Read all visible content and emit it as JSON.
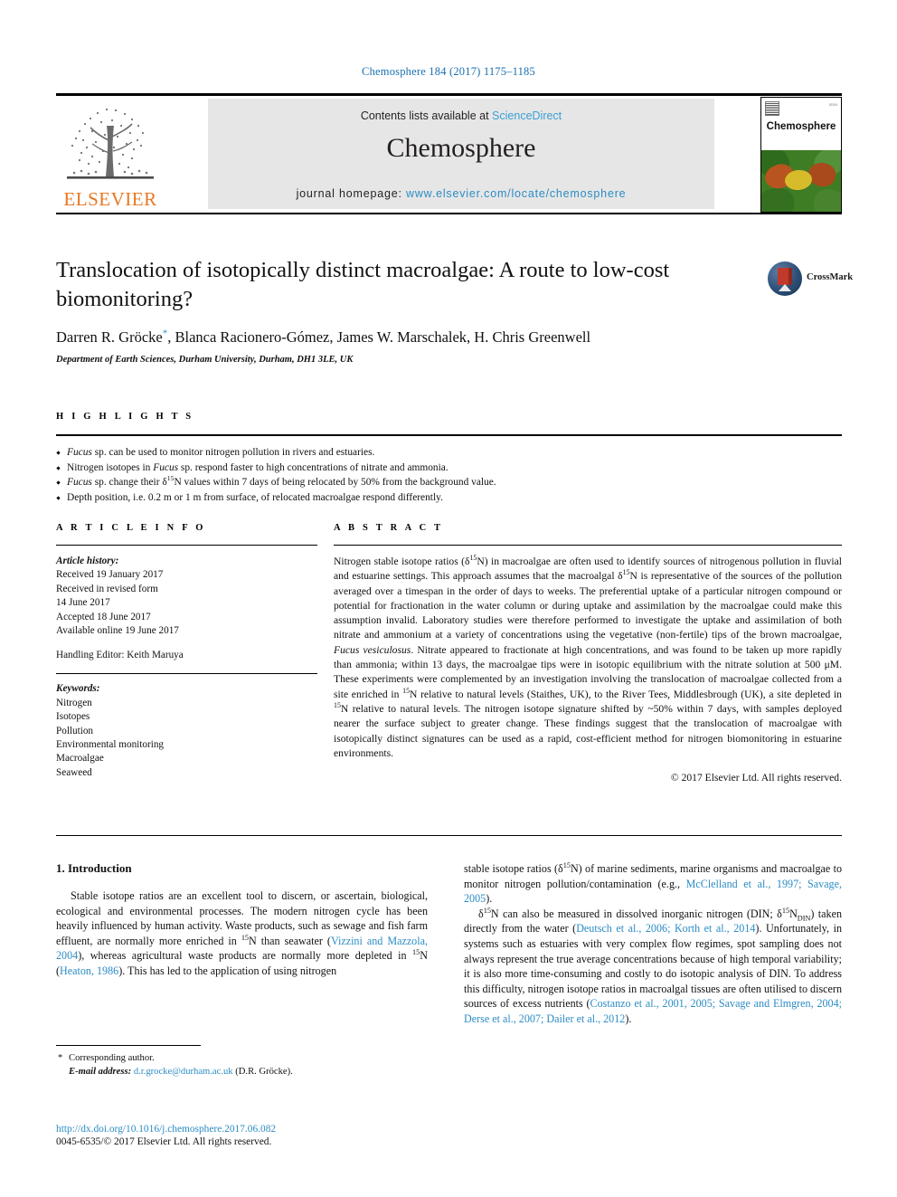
{
  "running_head": "Chemosphere 184 (2017) 1175–1185",
  "masthead": {
    "publisher_name": "ELSEVIER",
    "contents_prefix": "Contents lists available at",
    "contents_link": "ScienceDirect",
    "journal_name": "Chemosphere",
    "homepage_prefix": "journal homepage:",
    "homepage_link": "www.elsevier.com/locate/chemosphere",
    "cover_title": "Chemosphere"
  },
  "title": "Translocation of isotopically distinct macroalgae: A route to low-cost biomonitoring?",
  "crossmark_label": "CrossMark",
  "authors": "Darren R. Gröcke",
  "authors_rest": ", Blanca Racionero-Gómez, James W. Marschalek, H. Chris Greenwell",
  "author_marker": "*",
  "affiliation": "Department of Earth Sciences, Durham University, Durham, DH1 3LE, UK",
  "highlights": {
    "heading": "H I G H L I G H T S",
    "items": [
      {
        "italic": "Fucus",
        "rest": " sp. can be used to monitor nitrogen pollution in rivers and estuaries."
      },
      {
        "pre": "Nitrogen isotopes in ",
        "italic": "Fucus",
        "rest": " sp. respond faster to high concentrations of nitrate and ammonia."
      },
      {
        "italic": "Fucus",
        "rest": " sp. change their δ15N values within 7 days of being relocated by 50% from the background value."
      },
      {
        "rest": "Depth position, i.e. 0.2 m or 1 m from surface, of relocated macroalgae respond differently."
      }
    ]
  },
  "article_info": {
    "heading": "A R T I C L E   I N F O",
    "history_label": "Article history:",
    "history_lines": [
      "Received 19 January 2017",
      "Received in revised form",
      "14 June 2017",
      "Accepted 18 June 2017",
      "Available online 19 June 2017"
    ],
    "editor": "Handling Editor: Keith Maruya",
    "keywords_label": "Keywords:",
    "keywords": [
      "Nitrogen",
      "Isotopes",
      "Pollution",
      "Environmental monitoring",
      "Macroalgae",
      "Seaweed"
    ]
  },
  "abstract": {
    "heading": "A B S T R A C T",
    "p1_a": "Nitrogen stable isotope ratios (δ",
    "p1_b": "N) in macroalgae are often used to identify sources of nitrogenous pollution in fluvial and estuarine settings. This approach assumes that the macroalgal δ",
    "p1_c": "N is representative of the sources of the pollution averaged over a timespan in the order of days to weeks. The preferential uptake of a particular nitrogen compound or potential for fractionation in the water column or during uptake and assimilation by the macroalgae could make this assumption invalid. Laboratory studies were therefore performed to investigate the uptake and assimilation of both nitrate and ammonium at a variety of concentrations using the vegetative (non-fertile) tips of the brown macroalgae, ",
    "species": "Fucus vesiculosus",
    "p1_d": ". Nitrate appeared to fractionate at high concentrations, and was found to be taken up more rapidly than ammonia; within 13 days, the macroalgae tips were in isotopic equilibrium with the nitrate solution at 500 μM. These experiments were complemented by an investigation involving the translocation of macroalgae collected from a site enriched in ",
    "p1_e": "N relative to natural levels (Staithes, UK), to the River Tees, Middlesbrough (UK), a site depleted in ",
    "p1_f": "N relative to natural levels. The nitrogen isotope signature shifted by ~50% within 7 days, with samples deployed nearer the surface subject to greater change. These findings suggest that the translocation of macroalgae with isotopically distinct signatures can be used as a rapid, cost-efficient method for nitrogen biomonitoring in estuarine environments.",
    "isotope_mass": "15",
    "copyright": "© 2017 Elsevier Ltd. All rights reserved."
  },
  "introduction": {
    "heading": "1. Introduction",
    "left_p1_a": "Stable isotope ratios are an excellent tool to discern, or ascertain, biological, ecological and environmental processes. The modern nitrogen cycle has been heavily influenced by human activity. Waste products, such as sewage and fish farm effluent, are normally more enriched in ",
    "left_p1_b": "N than seawater (",
    "cite1": "Vizzini and Mazzola, 2004",
    "left_p1_c": "), whereas agricultural waste products are normally more depleted in ",
    "left_p1_d": "N (",
    "cite2": "Heaton, 1986",
    "left_p1_e": "). This has led to the application of using nitrogen",
    "right_p1_a": "stable isotope ratios (δ",
    "right_p1_b": "N) of marine sediments, marine organisms and macroalgae to monitor nitrogen pollution/contamination (e.g., ",
    "cite3": "McClelland et al., 1997; Savage, 2005",
    "right_p1_c": ").",
    "right_p2_a": "N can also be measured in dissolved inorganic nitrogen (DIN; δ",
    "right_p2_sub": "DIN",
    "right_p2_b": ") taken directly from the water (",
    "cite4": "Deutsch et al., 2006; Korth et al., 2014",
    "right_p2_c": "). Unfortunately, in systems such as estuaries with very complex flow regimes, spot sampling does not always represent the true average concentrations because of high temporal variability; it is also more time-consuming and costly to do isotopic analysis of DIN. To address this difficulty, nitrogen isotope ratios in macroalgal tissues are often utilised to discern sources of excess nutrients (",
    "cite5": "Costanzo et al., 2001, 2005; Savage and Elmgren, 2004; Derse et al., 2007; Dailer et al., 2012",
    "right_p2_d": ")."
  },
  "footnotes": {
    "corresponding": "Corresponding author.",
    "email_label": "E-mail address:",
    "email": "d.r.grocke@durham.ac.uk",
    "email_owner": "(D.R. Gröcke).",
    "doi": "http://dx.doi.org/10.1016/j.chemosphere.2017.06.082",
    "issn": "0045-6535/© 2017 Elsevier Ltd. All rights reserved."
  }
}
